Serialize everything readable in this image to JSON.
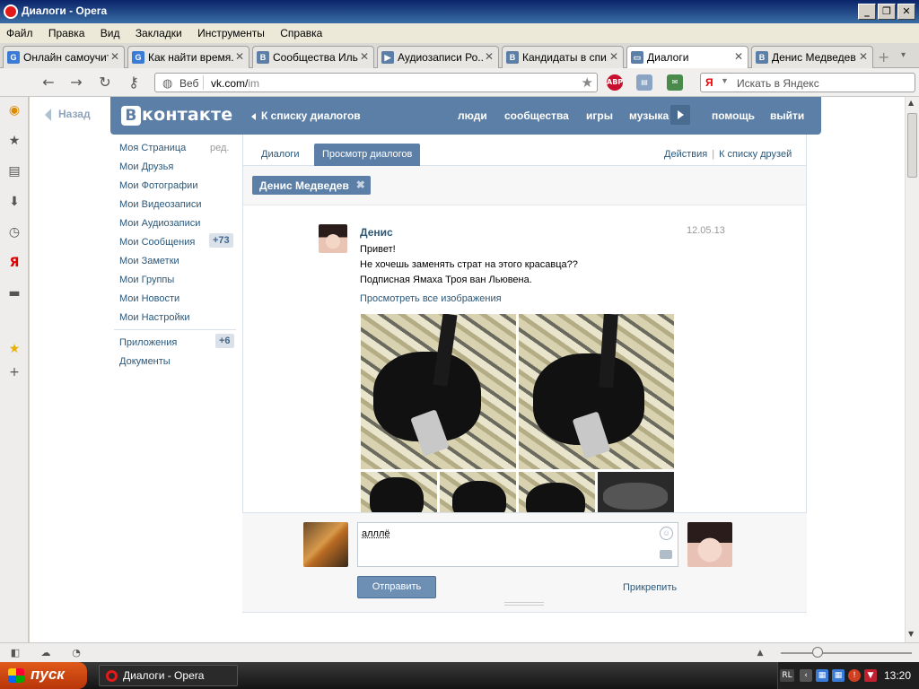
{
  "window": {
    "title": "Диалоги - Opera",
    "buttons": [
      "_",
      "❐",
      "✕"
    ]
  },
  "menu": [
    "Файл",
    "Правка",
    "Вид",
    "Закладки",
    "Инструменты",
    "Справка"
  ],
  "tabs": [
    {
      "label": "Онлайн самоучит...",
      "icon": "G",
      "icon_color": "#3a7bd5",
      "active": false
    },
    {
      "label": "Как найти время...",
      "icon": "G",
      "icon_color": "#3a7bd5",
      "active": false
    },
    {
      "label": "Сообщества Иль...",
      "icon": "B",
      "icon_color": "#5b7fa6",
      "active": false
    },
    {
      "label": "Аудиозаписи Ро...",
      "icon": "▶",
      "icon_color": "#5b7fa6",
      "active": false
    },
    {
      "label": "Кандидаты в спи...",
      "icon": "B",
      "icon_color": "#5b7fa6",
      "active": false
    },
    {
      "label": "Диалоги",
      "icon": "▭",
      "icon_color": "#5b7fa6",
      "active": true
    },
    {
      "label": "Денис Медведев",
      "icon": "B",
      "icon_color": "#5b7fa6",
      "active": false
    }
  ],
  "address": {
    "web_label": "Веб",
    "url_host": "vk.com/",
    "url_path": "im",
    "search_placeholder": "Искать в Яндекс"
  },
  "vk": {
    "back": "Назад",
    "logo_b": "В",
    "logo_rest": "контакте",
    "to_dialog_list": "К списку диалогов",
    "nav": [
      "люди",
      "сообщества",
      "игры",
      "музыка",
      "помощь",
      "выйти"
    ],
    "left_menu": [
      {
        "label": "Моя Страница",
        "extra": "ред."
      },
      {
        "label": "Мои Друзья"
      },
      {
        "label": "Мои Фотографии"
      },
      {
        "label": "Мои Видеозаписи"
      },
      {
        "label": "Мои Аудиозаписи"
      },
      {
        "label": "Мои Сообщения",
        "badge": "+73"
      },
      {
        "label": "Мои Заметки"
      },
      {
        "label": "Мои Группы"
      },
      {
        "label": "Мои Новости"
      },
      {
        "label": "Мои Настройки"
      }
    ],
    "left_menu_2": [
      {
        "label": "Приложения",
        "badge": "+6"
      },
      {
        "label": "Документы"
      }
    ],
    "tabs": {
      "dialogs": "Диалоги",
      "view": "Просмотр диалогов"
    },
    "actions": "Действия",
    "friends_list": "К списку друзей",
    "chip": "Денис Медведев",
    "message": {
      "author": "Денис",
      "date": "12.05.13",
      "lines": [
        "Привет!",
        "Не хочешь заменять страт на этого красавца??",
        "Подписная Ямаха Троя ван Льювена."
      ],
      "view_all": "Просмотреть все изображения"
    },
    "composer": {
      "text": "алллё",
      "send": "Отправить",
      "attach": "Прикрепить"
    }
  },
  "taskbar": {
    "start": "пуск",
    "item": "Диалоги - Opera",
    "lang": "RL",
    "clock": "13:20"
  }
}
